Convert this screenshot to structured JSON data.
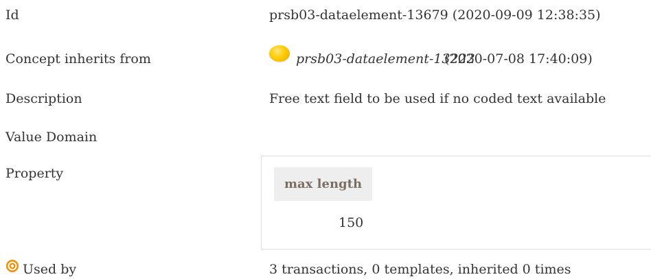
{
  "rows": {
    "id": {
      "label": "Id",
      "value": "prsb03-dataelement-13679 (2020-09-09 12:38:35)"
    },
    "inherits": {
      "label": "Concept inherits from",
      "icon": "yellow-dot-icon",
      "ref_id": "prsb03-dataelement-13223",
      "timestamp": "(2020-07-08 17:40:09)"
    },
    "description": {
      "label": "Description",
      "value": "Free text field to be used if no coded text available"
    },
    "value_domain": {
      "label": "Value Domain"
    },
    "property": {
      "label": "Property",
      "header": "max length",
      "value": "150"
    },
    "used_by": {
      "icon": "target-icon",
      "label": "Used by",
      "value": "3 transactions, 0 templates, inherited 0 times"
    }
  },
  "colors": {
    "text": "#333333",
    "header_bg": "#eeeeee",
    "header_text": "#7a6e63",
    "dot": "#ffcc00",
    "target": "#f28c00"
  }
}
